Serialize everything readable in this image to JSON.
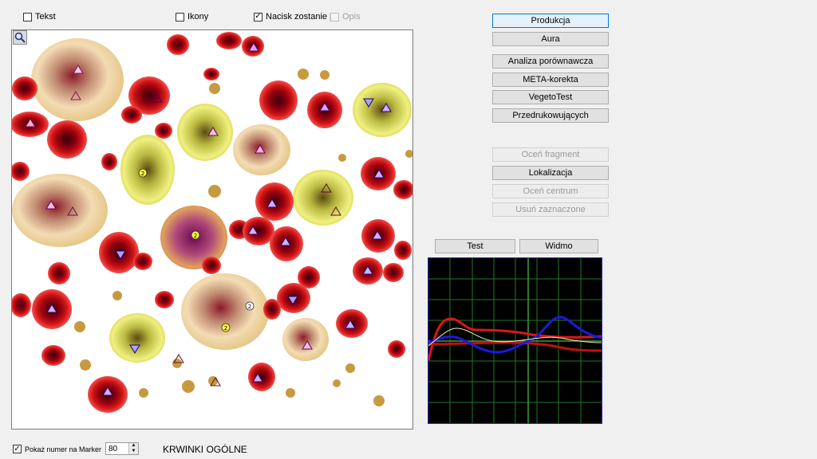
{
  "options": {
    "text": {
      "label": "Tekst",
      "checked": false
    },
    "icons": {
      "label": "Ikony",
      "checked": false
    },
    "pressure": {
      "label": "Nacisk zostanie p",
      "checked": true
    },
    "description": {
      "label": "Opis",
      "checked": false,
      "enabled": false
    }
  },
  "buttons_main": [
    {
      "label": "Produkcja"
    },
    {
      "label": "Aura"
    },
    {
      "label": "Analiza porównawcza"
    },
    {
      "label": "META-korekta"
    },
    {
      "label": "VegetoTest"
    },
    {
      "label": "Przedrukowujących"
    }
  ],
  "buttons_secondary": [
    {
      "label": "Oceń fragment",
      "enabled": false
    },
    {
      "label": "Lokalizacja",
      "enabled": true
    },
    {
      "label": "Oceń centrum",
      "enabled": false
    },
    {
      "label": "Usuń zaznaczone",
      "enabled": false
    }
  ],
  "spectrum_tabs": {
    "test": "Test",
    "widmo": "Widmo"
  },
  "bottom": {
    "marker_label": "Pokaż numer na Marker",
    "marker_checked": true,
    "spin_value": "80",
    "title": "KRWINKI OGÓLNE"
  },
  "colors": {
    "focus_border": "#0078d7",
    "curve_red": "#e01515",
    "curve_blue": "#1a1ae0",
    "curve_white": "#f0f0c0",
    "grid": "#1f7a1f"
  }
}
